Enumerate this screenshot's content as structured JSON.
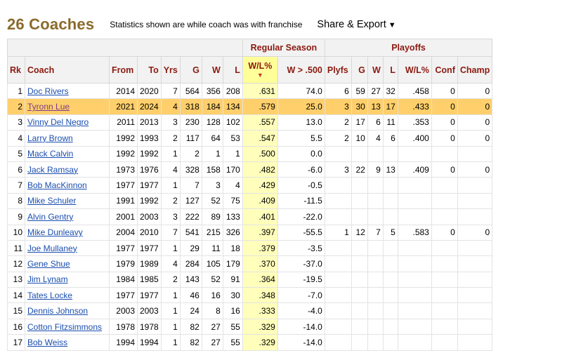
{
  "header": {
    "title": "26 Coaches",
    "subtitle": "Statistics shown are while coach was with franchise",
    "share_label": "Share & Export",
    "share_caret": "▼"
  },
  "table": {
    "group_headers": {
      "regular": "Regular Season",
      "playoffs": "Playoffs"
    },
    "columns": [
      "Rk",
      "Coach",
      "From",
      "To",
      "Yrs",
      "G",
      "W",
      "L",
      "W/L%",
      "W > .500",
      "Plyfs",
      "G",
      "W",
      "L",
      "W/L%",
      "Conf",
      "Champ"
    ],
    "sort_indicator": "▼",
    "highlight_row": 1,
    "rows": [
      [
        "1",
        "Doc Rivers",
        "2014",
        "2020",
        "7",
        "564",
        "356",
        "208",
        ".631",
        "74.0",
        "6",
        "59",
        "27",
        "32",
        ".458",
        "0",
        "0"
      ],
      [
        "2",
        "Tyronn Lue",
        "2021",
        "2024",
        "4",
        "318",
        "184",
        "134",
        ".579",
        "25.0",
        "3",
        "30",
        "13",
        "17",
        ".433",
        "0",
        "0"
      ],
      [
        "3",
        "Vinny Del Negro",
        "2011",
        "2013",
        "3",
        "230",
        "128",
        "102",
        ".557",
        "13.0",
        "2",
        "17",
        "6",
        "11",
        ".353",
        "0",
        "0"
      ],
      [
        "4",
        "Larry Brown",
        "1992",
        "1993",
        "2",
        "117",
        "64",
        "53",
        ".547",
        "5.5",
        "2",
        "10",
        "4",
        "6",
        ".400",
        "0",
        "0"
      ],
      [
        "5",
        "Mack Calvin",
        "1992",
        "1992",
        "1",
        "2",
        "1",
        "1",
        ".500",
        "0.0",
        "",
        "",
        "",
        "",
        "",
        "",
        ""
      ],
      [
        "6",
        "Jack Ramsay",
        "1973",
        "1976",
        "4",
        "328",
        "158",
        "170",
        ".482",
        "-6.0",
        "3",
        "22",
        "9",
        "13",
        ".409",
        "0",
        "0"
      ],
      [
        "7",
        "Bob MacKinnon",
        "1977",
        "1977",
        "1",
        "7",
        "3",
        "4",
        ".429",
        "-0.5",
        "",
        "",
        "",
        "",
        "",
        "",
        ""
      ],
      [
        "8",
        "Mike Schuler",
        "1991",
        "1992",
        "2",
        "127",
        "52",
        "75",
        ".409",
        "-11.5",
        "",
        "",
        "",
        "",
        "",
        "",
        ""
      ],
      [
        "9",
        "Alvin Gentry",
        "2001",
        "2003",
        "3",
        "222",
        "89",
        "133",
        ".401",
        "-22.0",
        "",
        "",
        "",
        "",
        "",
        "",
        ""
      ],
      [
        "10",
        "Mike Dunleavy",
        "2004",
        "2010",
        "7",
        "541",
        "215",
        "326",
        ".397",
        "-55.5",
        "1",
        "12",
        "7",
        "5",
        ".583",
        "0",
        "0"
      ],
      [
        "11",
        "Joe Mullaney",
        "1977",
        "1977",
        "1",
        "29",
        "11",
        "18",
        ".379",
        "-3.5",
        "",
        "",
        "",
        "",
        "",
        "",
        ""
      ],
      [
        "12",
        "Gene Shue",
        "1979",
        "1989",
        "4",
        "284",
        "105",
        "179",
        ".370",
        "-37.0",
        "",
        "",
        "",
        "",
        "",
        "",
        ""
      ],
      [
        "13",
        "Jim Lynam",
        "1984",
        "1985",
        "2",
        "143",
        "52",
        "91",
        ".364",
        "-19.5",
        "",
        "",
        "",
        "",
        "",
        "",
        ""
      ],
      [
        "14",
        "Tates Locke",
        "1977",
        "1977",
        "1",
        "46",
        "16",
        "30",
        ".348",
        "-7.0",
        "",
        "",
        "",
        "",
        "",
        "",
        ""
      ],
      [
        "15",
        "Dennis Johnson",
        "2003",
        "2003",
        "1",
        "24",
        "8",
        "16",
        ".333",
        "-4.0",
        "",
        "",
        "",
        "",
        "",
        "",
        ""
      ],
      [
        "16",
        "Cotton Fitzsimmons",
        "1978",
        "1978",
        "1",
        "82",
        "27",
        "55",
        ".329",
        "-14.0",
        "",
        "",
        "",
        "",
        "",
        "",
        ""
      ],
      [
        "17",
        "Bob Weiss",
        "1994",
        "1994",
        "1",
        "82",
        "27",
        "55",
        ".329",
        "-14.0",
        "",
        "",
        "",
        "",
        "",
        "",
        ""
      ]
    ]
  }
}
